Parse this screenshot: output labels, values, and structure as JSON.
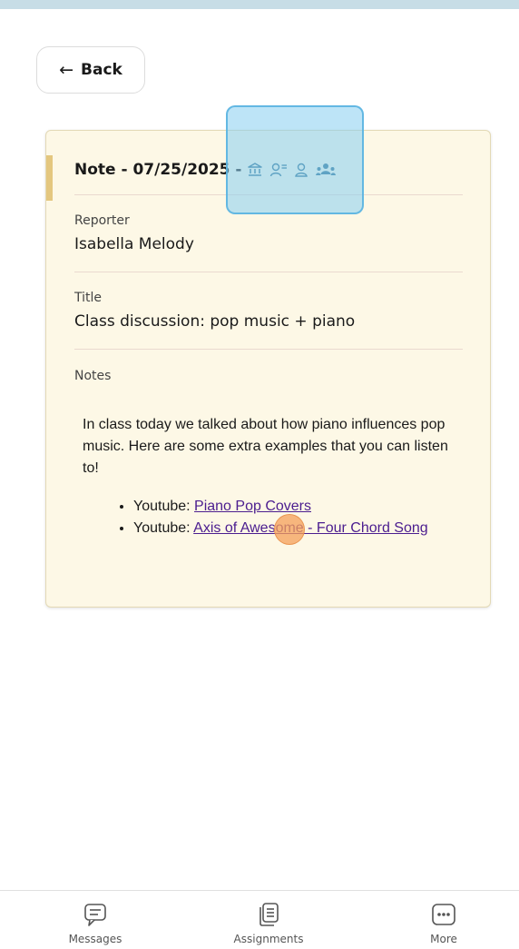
{
  "header": {
    "back_label": "Back"
  },
  "note": {
    "heading": "Note - 07/25/2025 -",
    "icons": [
      "institution-icon",
      "people-list-icon",
      "person-icon",
      "group-icon"
    ],
    "reporter_label": "Reporter",
    "reporter_value": "Isabella Melody",
    "title_label": "Title",
    "title_value": "Class discussion: pop music + piano",
    "notes_label": "Notes",
    "notes_text": "In class today we talked about how piano influences pop music. Here are some extra examples that you can listen to!",
    "links": [
      {
        "prefix": "Youtube: ",
        "text": "Piano Pop Covers"
      },
      {
        "prefix": "Youtube: ",
        "text": "Axis of Awesome - Four Chord Song"
      }
    ]
  },
  "bottom_nav": {
    "items": [
      {
        "label": "Messages",
        "icon": "message-icon"
      },
      {
        "label": "Assignments",
        "icon": "assignments-icon"
      },
      {
        "label": "More",
        "icon": "more-icon"
      }
    ]
  },
  "colors": {
    "card_bg": "#fdf8e6",
    "accent": "#e4c77f",
    "link": "#4b1d8f",
    "icon_blue": "#2f6f8f"
  }
}
